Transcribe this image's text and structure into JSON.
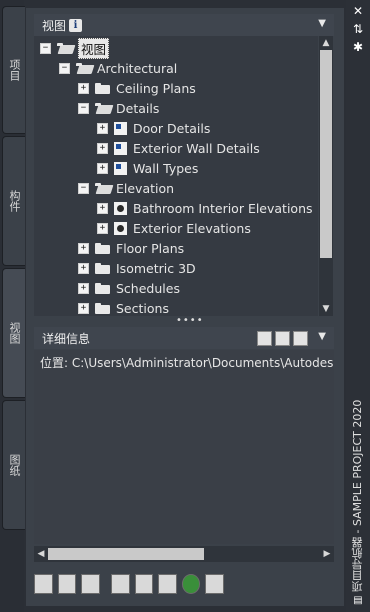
{
  "tabs": [
    {
      "label": "项目",
      "active": false
    },
    {
      "label": "构件",
      "active": false
    },
    {
      "label": "视图",
      "active": true
    },
    {
      "label": "图纸",
      "active": false
    }
  ],
  "right_strip": {
    "close_icon": "close-icon",
    "pin_icon": "pin-icon",
    "settings_icon": "gear-icon",
    "title": "项目导航器 - SAMPLE PROJECT 2020"
  },
  "views_panel": {
    "title": "视图",
    "info_badge": "i",
    "dropdown_glyph": "▼"
  },
  "tree": [
    {
      "label": "视图",
      "level": 0,
      "expander": "−",
      "icon": "open-folder",
      "selected": true
    },
    {
      "label": "Architectural",
      "level": 1,
      "expander": "−",
      "icon": "open-folder"
    },
    {
      "label": "Ceiling Plans",
      "level": 2,
      "expander": "+",
      "icon": "folder"
    },
    {
      "label": "Details",
      "level": 2,
      "expander": "−",
      "icon": "open-folder"
    },
    {
      "label": "Door Details",
      "level": 3,
      "expander": "+",
      "icon": "view"
    },
    {
      "label": "Exterior Wall Details",
      "level": 3,
      "expander": "+",
      "icon": "view"
    },
    {
      "label": "Wall Types",
      "level": 3,
      "expander": "+",
      "icon": "view"
    },
    {
      "label": "Elevation",
      "level": 2,
      "expander": "−",
      "icon": "open-folder"
    },
    {
      "label": "Bathroom Interior Elevations",
      "level": 3,
      "expander": "+",
      "icon": "elevation"
    },
    {
      "label": "Exterior Elevations",
      "level": 3,
      "expander": "+",
      "icon": "elevation"
    },
    {
      "label": "Floor Plans",
      "level": 2,
      "expander": "+",
      "icon": "folder"
    },
    {
      "label": "Isometric 3D",
      "level": 2,
      "expander": "+",
      "icon": "folder"
    },
    {
      "label": "Schedules",
      "level": 2,
      "expander": "+",
      "icon": "folder"
    },
    {
      "label": "Sections",
      "level": 2,
      "expander": "+",
      "icon": "folder"
    }
  ],
  "details_panel": {
    "title": "详细信息",
    "location_text": "位置: C:\\Users\\Administrator\\Documents\\Autodesk\\"
  },
  "toolbar_icons": [
    "new-view-icon",
    "new-view-drawing-icon",
    "new-sheet-icon",
    "show-drawings-icon",
    "select-tool-icon",
    "properties-icon",
    "refresh-icon",
    "more-icon"
  ],
  "colors": {
    "accent": "#3a8f3a",
    "selection": "#e8e8e8"
  }
}
